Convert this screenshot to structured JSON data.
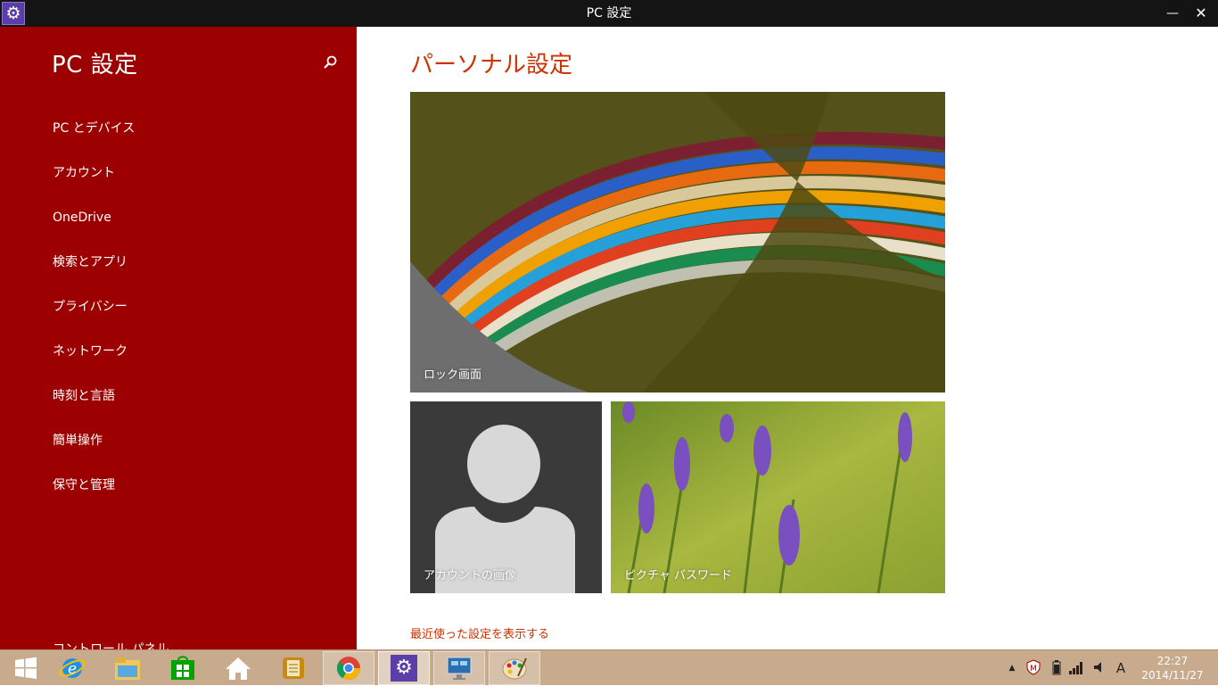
{
  "window": {
    "title": "PC 設定"
  },
  "sidebar": {
    "title": "PC 設定",
    "items": [
      {
        "label": "PC とデバイス"
      },
      {
        "label": "アカウント"
      },
      {
        "label": "OneDrive"
      },
      {
        "label": "検索とアプリ"
      },
      {
        "label": "プライバシー"
      },
      {
        "label": "ネットワーク"
      },
      {
        "label": "時刻と言語"
      },
      {
        "label": "簡単操作"
      },
      {
        "label": "保守と管理"
      }
    ],
    "control_panel": "コントロール パネル"
  },
  "main": {
    "title": "パーソナル設定",
    "tiles": {
      "lock": "ロック画面",
      "account": "アカウントの画像",
      "picture": "ピクチャ パスワード"
    },
    "recent_link": "最近使った設定を表示する"
  },
  "taskbar": {
    "apps": [
      "start-icon",
      "ie-icon",
      "file-explorer-icon",
      "store-icon",
      "home-icon",
      "notes-icon",
      "chrome-icon",
      "settings-icon",
      "remote-desktop-icon",
      "paint-icon"
    ],
    "ime": "A"
  },
  "clock": {
    "time": "22:27",
    "date": "2014/11/27"
  },
  "colors": {
    "accent": "#9c0000",
    "title_red": "#cc3300",
    "taskbar": "#c8ab8d"
  }
}
